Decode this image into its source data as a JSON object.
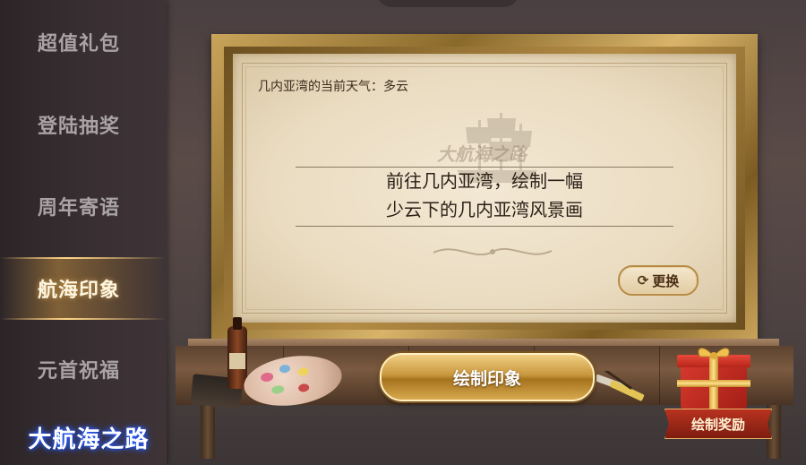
{
  "sidebar": {
    "items": [
      {
        "label": "超值礼包"
      },
      {
        "label": "登陆抽奖"
      },
      {
        "label": "周年寄语"
      },
      {
        "label": "航海印象"
      },
      {
        "label": "元首祝福"
      }
    ],
    "active_item": "航海印象"
  },
  "logo": {
    "text": "大航海之路"
  },
  "canvas": {
    "weather_text": "几内亚湾的当前天气：多云",
    "watermark_text": "大航海之路",
    "task_line1": "前往几内亚湾，绘制一幅",
    "task_line2": "少云下的几内亚湾风景画",
    "change_label": "更换",
    "change_icon": "refresh-icon"
  },
  "actions": {
    "draw_label": "绘制印象",
    "reward_label": "绘制奖励"
  },
  "colors": {
    "frame_gold": "#c9a45a",
    "button_gold": "#c9973d",
    "reward_red": "#b8321f",
    "canvas_bg": "#eadcc1",
    "sidebar_bg": "#3a3033"
  }
}
